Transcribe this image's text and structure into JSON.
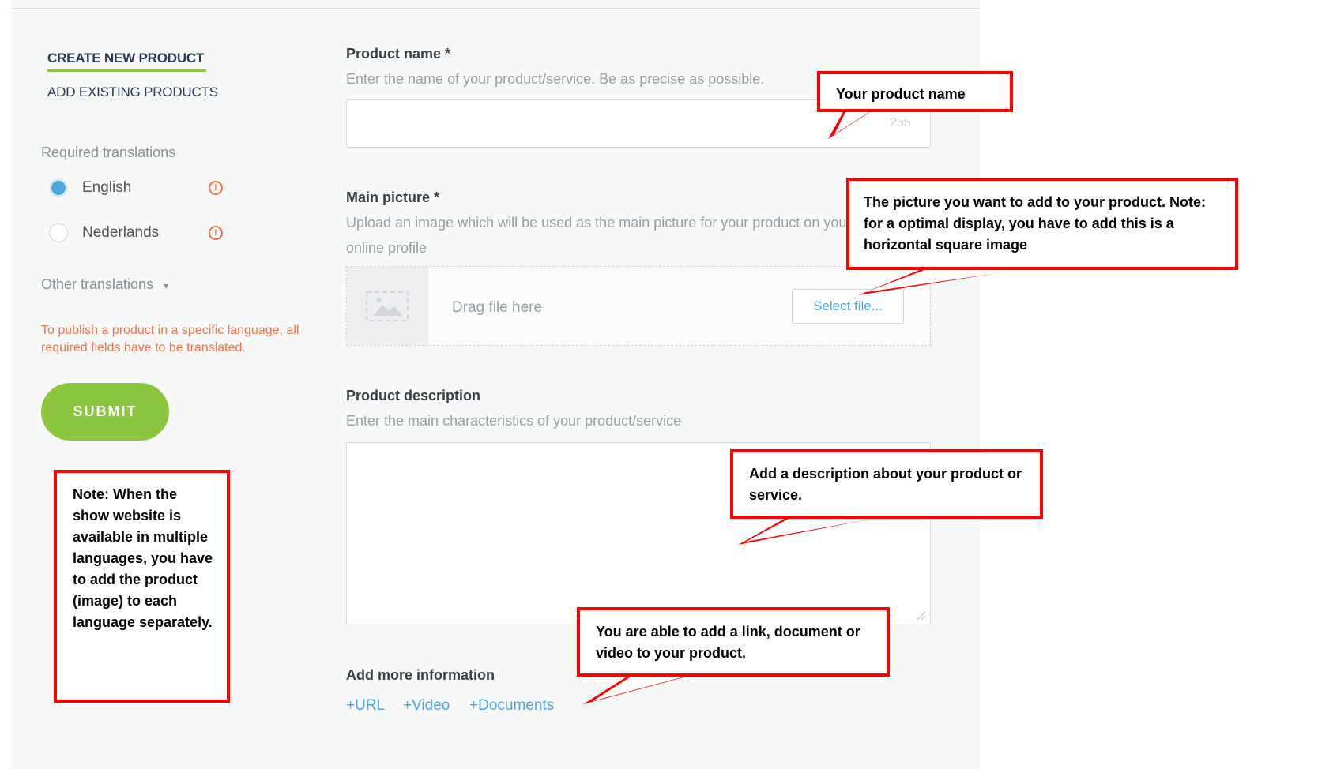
{
  "nav": {
    "create_label": "CREATE NEW PRODUCT",
    "existing_label": "ADD EXISTING PRODUCTS"
  },
  "translations": {
    "required_label": "Required translations",
    "languages": [
      {
        "name": "English",
        "selected": true
      },
      {
        "name": "Nederlands",
        "selected": false
      }
    ],
    "warning_glyph": "!",
    "other_label": "Other translations",
    "other_caret": "▾",
    "publish_note": "To publish a product in a specific language, all required fields have to be translated."
  },
  "submit_label": "SUBMIT",
  "form": {
    "name": {
      "label": "Product name *",
      "help": "Enter the name of your product/service. Be as precise as possible.",
      "value": "",
      "counter": "255"
    },
    "picture": {
      "label": "Main picture *",
      "help": "Upload an image which will be used as the main picture for your product on your online profile",
      "drop_text": "Drag file here",
      "select_label": "Select file..."
    },
    "description": {
      "label": "Product description",
      "help": "Enter the main characteristics of your product/service",
      "value": ""
    },
    "more": {
      "label": "Add more information",
      "links": [
        "+URL",
        "+Video",
        "+Documents"
      ]
    }
  },
  "callouts": {
    "name": "Your product name",
    "picture": "The picture you want to add to your product. Note: for a optimal display, you have to add this is a horizontal square image",
    "description": "Add a description about your product or service.",
    "more": "You are able to add a link, document or video to your product.",
    "languages": "Note: When the show website is available in multiple languages, you have to add the product (image) to each language separately."
  },
  "colors": {
    "accent_green": "#8cc63f",
    "accent_blue": "#4aa8e0",
    "warning_orange": "#f2734a",
    "callout_red": "#ff0000",
    "nav_text": "#2b3a55"
  }
}
